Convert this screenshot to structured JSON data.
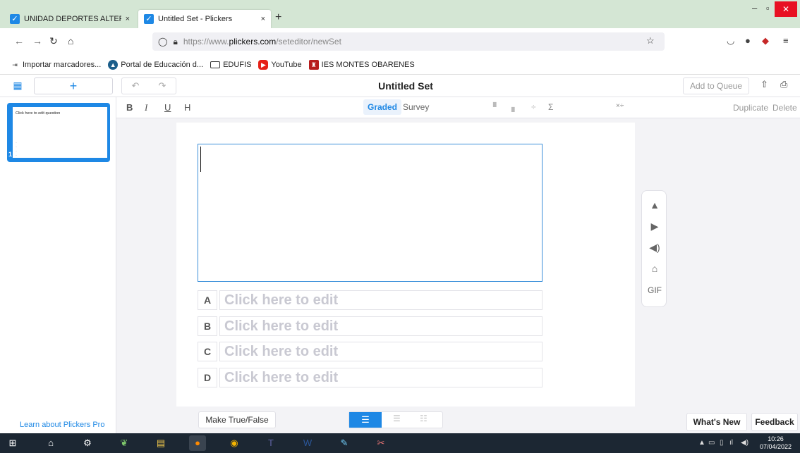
{
  "browser": {
    "tabs": [
      {
        "title": "UNIDAD DEPORTES ALTERNATI",
        "close": "×"
      },
      {
        "title": "Untitled Set - Plickers",
        "close": "×"
      }
    ],
    "new_tab": "+",
    "url_prefix": "https://www.",
    "url_host": "plickers.com",
    "url_path": "/seteditor/newSet",
    "bookmarks": [
      {
        "label": "Importar marcadores...",
        "icon": "import-icon"
      },
      {
        "label": "Portal de Educación d...",
        "icon": "portal-icon"
      },
      {
        "label": "EDUFIS",
        "icon": "folder-icon"
      },
      {
        "label": "YouTube",
        "icon": "youtube-icon"
      },
      {
        "label": "IES MONTES OBARENES",
        "icon": "school-icon"
      }
    ]
  },
  "app": {
    "set_title": "Untitled Set",
    "add_to_queue": "Add to Queue",
    "format": {
      "bold": "B",
      "italic": "I",
      "underline": "U",
      "heading": "H"
    },
    "mode_graded": "Graded",
    "mode_survey": "Survey",
    "duplicate": "Duplicate",
    "delete": "Delete",
    "slide": {
      "question": "Click here to edit question",
      "number": "1"
    },
    "answers": [
      {
        "letter": "A",
        "placeholder": "Click here to edit"
      },
      {
        "letter": "B",
        "placeholder": "Click here to edit"
      },
      {
        "letter": "C",
        "placeholder": "Click here to edit"
      },
      {
        "letter": "D",
        "placeholder": "Click here to edit"
      }
    ],
    "media_gif": "GIF",
    "make_true_false": "Make True/False",
    "learn_pro": "Learn about Plickers Pro",
    "whats_new": "What's New",
    "feedback": "Feedback"
  },
  "taskbar": {
    "time": "10:26",
    "date": "07/04/2022"
  },
  "colors": {
    "accent": "#1e88e5",
    "tabstrip": "#d4e6d4",
    "taskbar": "#1c2733"
  }
}
